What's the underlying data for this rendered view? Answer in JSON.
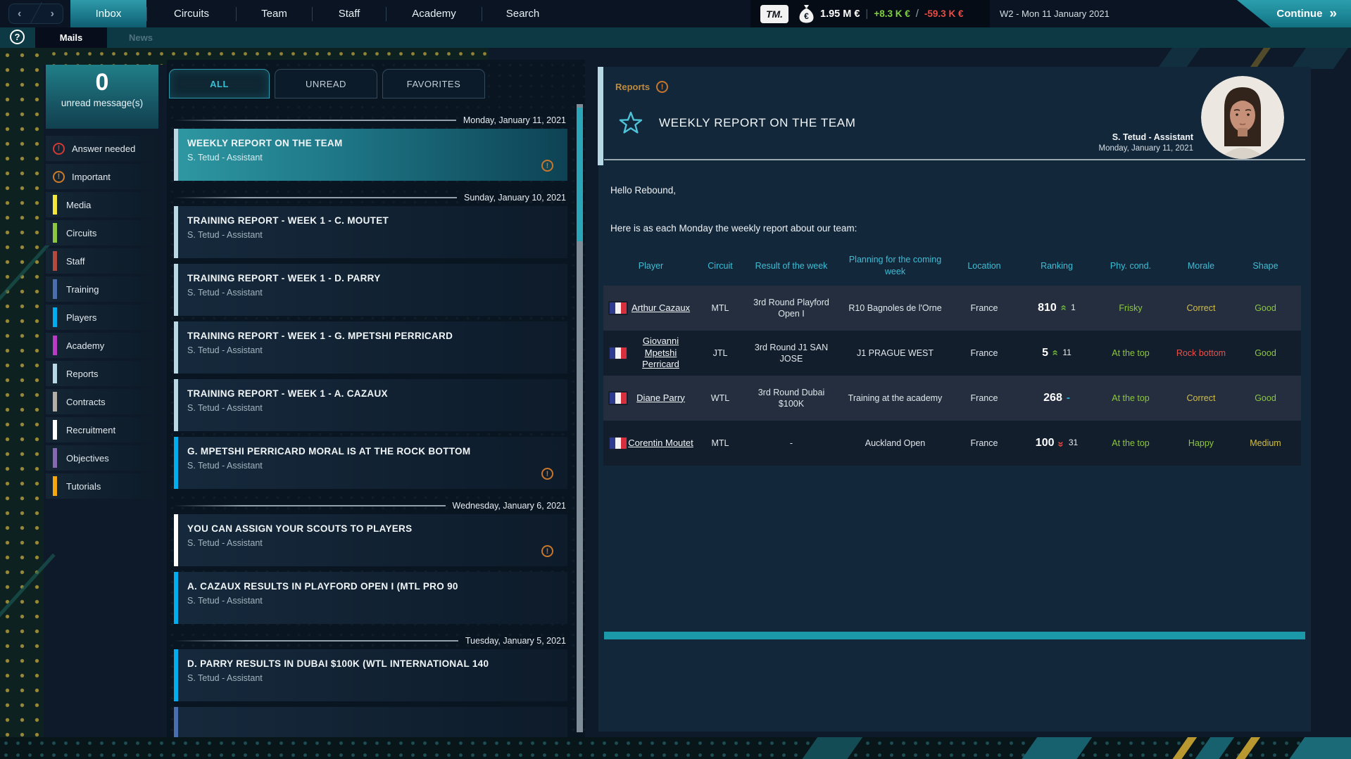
{
  "icons": {
    "back": "‹",
    "forward": "›",
    "help": "?",
    "alert": "!",
    "continue_chevron": "»",
    "trend_chevron": "»",
    "star": "star-outline"
  },
  "colors": {
    "accent": "#2ba6b8",
    "status": {
      "green": "#8cc63e",
      "yellow": "#d2bf4a",
      "red": "#e8514b",
      "cyan": "#2cb5d6"
    },
    "trend_up": "#6db33f",
    "trend_down": "#e0493e",
    "alert_red": "#d03a34",
    "alert_orange": "#cc7a28"
  },
  "top_nav": {
    "logo": "TM.",
    "tabs": [
      {
        "label": "Inbox",
        "active": true
      },
      {
        "label": "Circuits",
        "active": false
      },
      {
        "label": "Team",
        "active": false
      },
      {
        "label": "Staff",
        "active": false
      },
      {
        "label": "Academy",
        "active": false
      },
      {
        "label": "Search",
        "active": false
      }
    ],
    "finance": {
      "balance": "1.95 M €",
      "sep1": "|",
      "gain": "+8.3 K €",
      "sep2": "/",
      "loss": "-59.3 K €"
    },
    "date": "W2 - Mon 11 January 2021",
    "continue_label": "Continue"
  },
  "sub_nav": {
    "tabs": [
      {
        "label": "Mails",
        "active": true
      },
      {
        "label": "News",
        "active": false
      }
    ]
  },
  "sidebar": {
    "unread_count": "0",
    "unread_label": "unread message(s)",
    "items": [
      {
        "label": "Answer needed",
        "icon": "alert-circle",
        "icon_color": "#d03a34"
      },
      {
        "label": "Important",
        "icon": "alert-circle",
        "icon_color": "#cc7a28"
      },
      {
        "label": "Media",
        "color": "#f2e63c"
      },
      {
        "label": "Circuits",
        "color": "#8dc63f"
      },
      {
        "label": "Staff",
        "color": "#b44a3e"
      },
      {
        "label": "Training",
        "color": "#4a6fae"
      },
      {
        "label": "Players",
        "color": "#00aeef"
      },
      {
        "label": "Academy",
        "color": "#bb3cc4"
      },
      {
        "label": "Reports",
        "color": "#b9d8e6"
      },
      {
        "label": "Contracts",
        "color": "#b3afa6"
      },
      {
        "label": "Recruitment",
        "color": "#ffffff"
      },
      {
        "label": "Objectives",
        "color": "#8468b0"
      },
      {
        "label": "Tutorials",
        "color": "#f5a80e"
      }
    ]
  },
  "mail_list": {
    "tabs": [
      {
        "label": "ALL",
        "active": true
      },
      {
        "label": "UNREAD",
        "active": false
      },
      {
        "label": "FAVORITES",
        "active": false
      }
    ],
    "groups": [
      {
        "date": "Monday, January 11, 2021",
        "mails": [
          {
            "title": "WEEKLY REPORT ON THE TEAM",
            "sender": "S. Tetud - Assistant",
            "bar": "#b9d8e6",
            "selected": true,
            "important": true
          }
        ]
      },
      {
        "date": "Sunday, January 10, 2021",
        "mails": [
          {
            "title": "TRAINING REPORT - WEEK 1 - C. MOUTET",
            "sender": "S. Tetud - Assistant",
            "bar": "#b9d8e6"
          },
          {
            "title": "TRAINING REPORT - WEEK 1 - D. PARRY",
            "sender": "S. Tetud - Assistant",
            "bar": "#b9d8e6"
          },
          {
            "title": "TRAINING REPORT - WEEK 1 - G. MPETSHI PERRICARD",
            "sender": "S. Tetud - Assistant",
            "bar": "#b9d8e6"
          },
          {
            "title": "TRAINING REPORT - WEEK 1 - A. CAZAUX",
            "sender": "S. Tetud - Assistant",
            "bar": "#b9d8e6"
          },
          {
            "title": "G. MPETSHI PERRICARD MORAL IS AT THE ROCK BOTTOM",
            "sender": "S. Tetud - Assistant",
            "bar": "#00aeef",
            "important": true
          }
        ]
      },
      {
        "date": "Wednesday, January 6, 2021",
        "mails": [
          {
            "title": "YOU CAN ASSIGN YOUR SCOUTS TO PLAYERS",
            "sender": "S. Tetud - Assistant",
            "bar": "#ffffff",
            "important": true
          },
          {
            "title": "A. CAZAUX RESULTS IN PLAYFORD OPEN I (MTL PRO 90",
            "sender": "S. Tetud - Assistant",
            "bar": "#00aeef"
          }
        ]
      },
      {
        "date": "Tuesday, January 5, 2021",
        "mails": [
          {
            "title": "D. PARRY RESULTS IN DUBAI $100K (WTL INTERNATIONAL 140",
            "sender": "S. Tetud - Assistant",
            "bar": "#00aeef"
          },
          {
            "title": "",
            "sender": "",
            "bar": "#4a6fae",
            "partial": true
          }
        ]
      }
    ]
  },
  "reader": {
    "category": "Reports",
    "title": "WEEKLY REPORT ON THE TEAM",
    "sender": "S. Tetud - Assistant",
    "date": "Monday, January 11, 2021",
    "greeting": "Hello Rebound,",
    "intro": "Here is as each Monday the weekly report about our team:",
    "table": {
      "columns": [
        "Player",
        "Circuit",
        "Result of the week",
        "Planning for the coming week",
        "Location",
        "Ranking",
        "Phy. cond.",
        "Morale",
        "Shape"
      ],
      "rows": [
        {
          "player": "Arthur Cazaux",
          "flag": "france",
          "circuit": "MTL",
          "result": "3rd Round Playford Open I",
          "planning": "R10 Bagnoles de l'Orne",
          "location": "France",
          "ranking": "810",
          "trend": "up",
          "trend_value": "1",
          "phy": "Frisky",
          "phy_color": "green",
          "morale": "Correct",
          "morale_color": "yellow",
          "shape": "Good",
          "shape_color": "green"
        },
        {
          "player": "Giovanni Mpetshi Perricard",
          "flag": "france",
          "circuit": "JTL",
          "result": "3rd Round J1 SAN JOSE",
          "planning": "J1 PRAGUE WEST",
          "location": "France",
          "ranking": "5",
          "trend": "up",
          "trend_value": "11",
          "phy": "At the top",
          "phy_color": "green",
          "morale": "Rock bottom",
          "morale_color": "red",
          "shape": "Good",
          "shape_color": "green"
        },
        {
          "player": "Diane Parry",
          "flag": "france",
          "circuit": "WTL",
          "result": "3rd Round Dubai $100K",
          "planning": "Training at the academy",
          "location": "France",
          "ranking": "268",
          "trend": "same",
          "trend_value": "-",
          "phy": "At the top",
          "phy_color": "green",
          "morale": "Correct",
          "morale_color": "yellow",
          "shape": "Good",
          "shape_color": "green"
        },
        {
          "player": "Corentin Moutet",
          "flag": "france",
          "circuit": "MTL",
          "result": "-",
          "planning": "Auckland Open",
          "location": "France",
          "ranking": "100",
          "trend": "down",
          "trend_value": "31",
          "phy": "At the top",
          "phy_color": "green",
          "morale": "Happy",
          "morale_color": "green",
          "shape": "Medium",
          "shape_color": "yellow"
        }
      ]
    }
  }
}
